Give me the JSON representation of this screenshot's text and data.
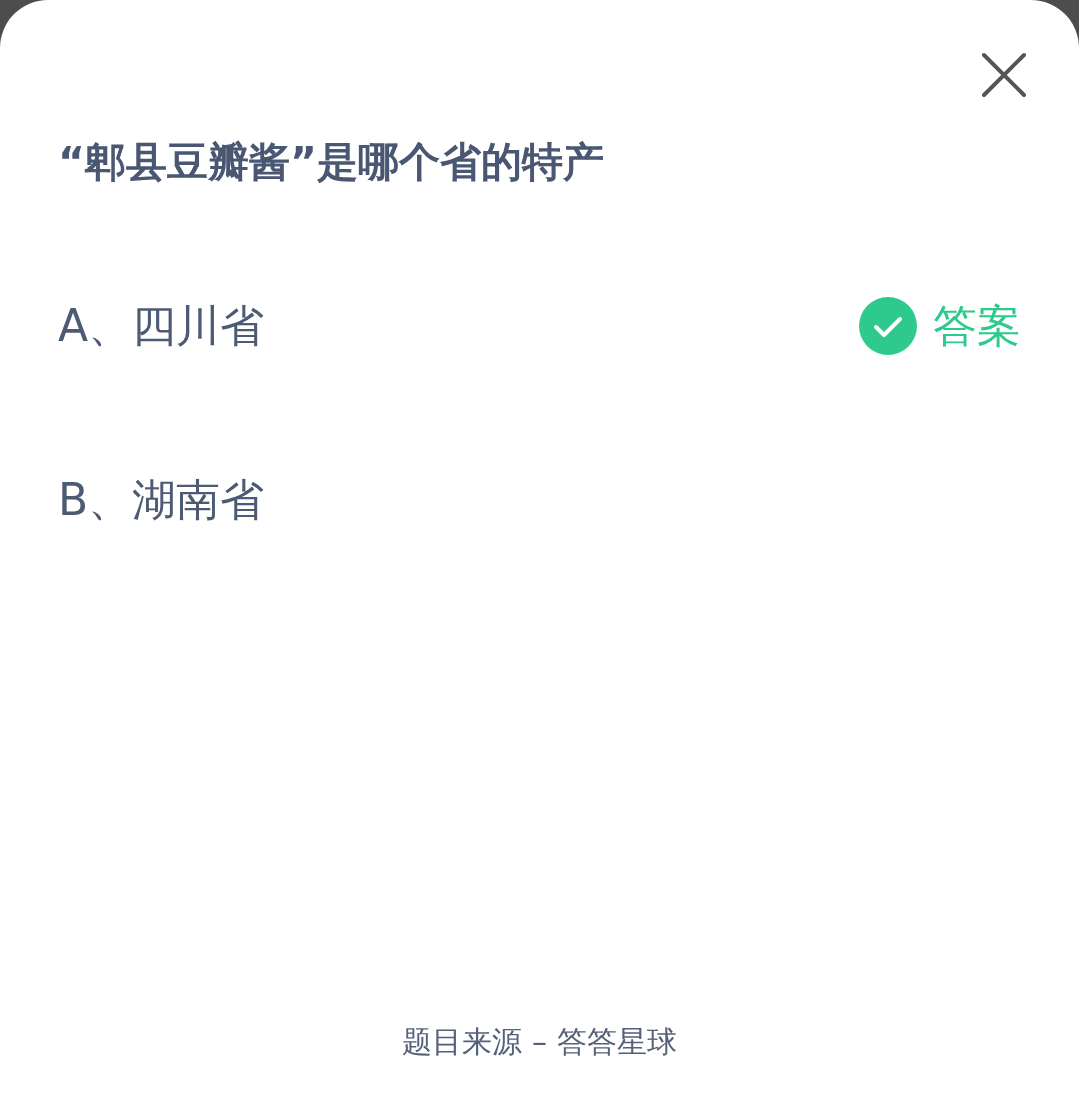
{
  "question": "“郫县豆瓣酱”是哪个省的特产",
  "options": [
    {
      "label": "A、四川省",
      "correct": true
    },
    {
      "label": "B、湖南省",
      "correct": false
    }
  ],
  "answer_label": "答案",
  "footer": "题目来源 – 答答星球"
}
